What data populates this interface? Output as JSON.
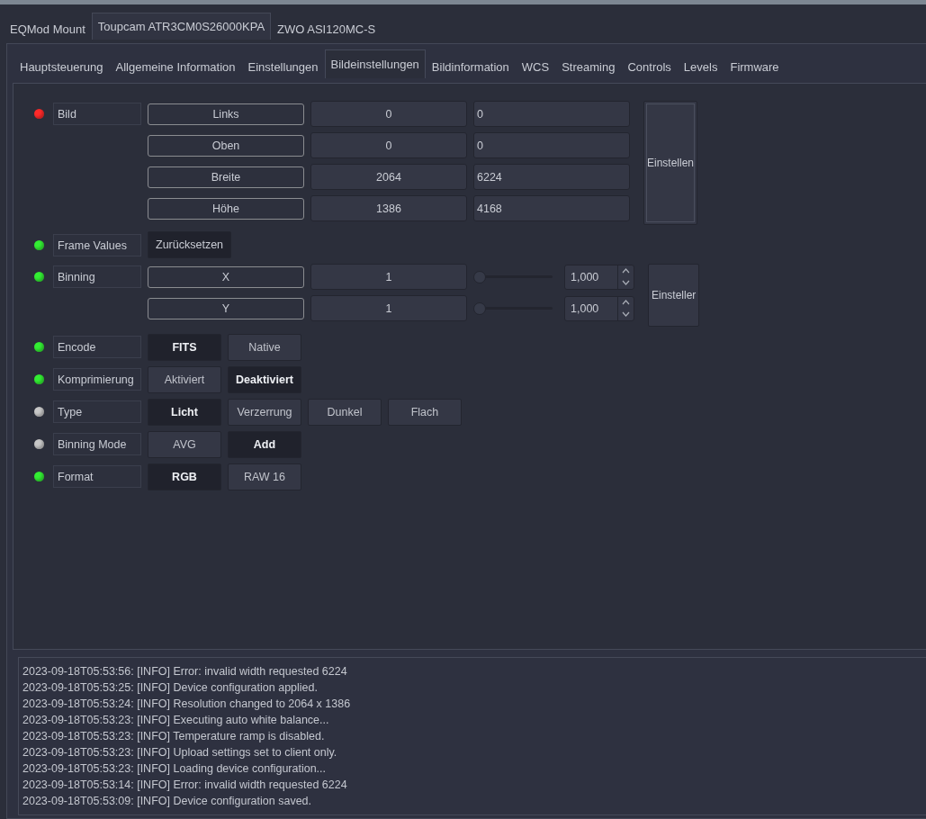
{
  "device_tabs": [
    {
      "label": "EQMod Mount",
      "selected": false
    },
    {
      "label": "Toupcam ATR3CM0S26000KPA",
      "selected": true
    },
    {
      "label": "ZWO ASI120MC-S",
      "selected": false
    }
  ],
  "tabs": [
    {
      "label": "Hauptsteuerung",
      "selected": false
    },
    {
      "label": "Allgemeine Information",
      "selected": false
    },
    {
      "label": "Einstellungen",
      "selected": false
    },
    {
      "label": "Bildeinstellungen",
      "selected": true
    },
    {
      "label": "Bildinformation",
      "selected": false
    },
    {
      "label": "WCS",
      "selected": false
    },
    {
      "label": "Streaming",
      "selected": false
    },
    {
      "label": "Controls",
      "selected": false
    },
    {
      "label": "Levels",
      "selected": false
    },
    {
      "label": "Firmware",
      "selected": false
    }
  ],
  "properties": [
    {
      "kind": "numbers",
      "label": "Bild",
      "color": "#ff2a2a",
      "set_button": "Einstellen",
      "rows": [
        {
          "name": "Links",
          "value": "0",
          "target": "0"
        },
        {
          "name": "Oben",
          "value": "0",
          "target": "0"
        },
        {
          "name": "Breite",
          "value": "2064",
          "target": "6224"
        },
        {
          "name": "Höhe",
          "value": "1386",
          "target": "4168"
        }
      ]
    },
    {
      "kind": "action",
      "label": "Frame Values",
      "color": "#33ee33",
      "button": "Zurücksetzen"
    },
    {
      "kind": "sliders",
      "label": "Binning",
      "color": "#33ee33",
      "set_button": "Einsteller",
      "rows": [
        {
          "name": "X",
          "value": "1",
          "level": 0,
          "spin": "1,000"
        },
        {
          "name": "Y",
          "value": "1",
          "level": 0,
          "spin": "1,000"
        }
      ]
    },
    {
      "kind": "switches",
      "label": "Encode",
      "color": "#33ee33",
      "options": [
        {
          "label": "FITS",
          "selected": true
        },
        {
          "label": "Native",
          "selected": false
        }
      ]
    },
    {
      "kind": "switches",
      "label": "Komprimierung",
      "color": "#33ee33",
      "options": [
        {
          "label": "Aktiviert",
          "selected": false
        },
        {
          "label": "Deaktiviert",
          "selected": true
        }
      ]
    },
    {
      "kind": "switches",
      "label": "Type",
      "color": "#c8c8c8",
      "options": [
        {
          "label": "Licht",
          "selected": true
        },
        {
          "label": "Verzerrung",
          "selected": false
        },
        {
          "label": "Dunkel",
          "selected": false
        },
        {
          "label": "Flach",
          "selected": false
        }
      ]
    },
    {
      "kind": "switches",
      "label": "Binning Mode",
      "color": "#c8c8c8",
      "options": [
        {
          "label": "AVG",
          "selected": false
        },
        {
          "label": "Add",
          "selected": true
        }
      ]
    },
    {
      "kind": "switches",
      "label": "Format",
      "color": "#33ee33",
      "options": [
        {
          "label": "RGB",
          "selected": true
        },
        {
          "label": "RAW 16",
          "selected": false
        }
      ]
    }
  ],
  "log": [
    "2023-09-18T05:53:56: [INFO] Error: invalid width requested 6224",
    "2023-09-18T05:53:25: [INFO] Device configuration applied.",
    "2023-09-18T05:53:24: [INFO] Resolution changed to 2064 x 1386",
    "2023-09-18T05:53:23: [INFO] Executing auto white balance...",
    "2023-09-18T05:53:23: [INFO] Temperature ramp is disabled.",
    "2023-09-18T05:53:23: [INFO] Upload settings set to client only.",
    "2023-09-18T05:53:23: [INFO] Loading device configuration...",
    "2023-09-18T05:53:14: [INFO] Error: invalid width requested 6224",
    "2023-09-18T05:53:09: [INFO] Device configuration saved."
  ]
}
